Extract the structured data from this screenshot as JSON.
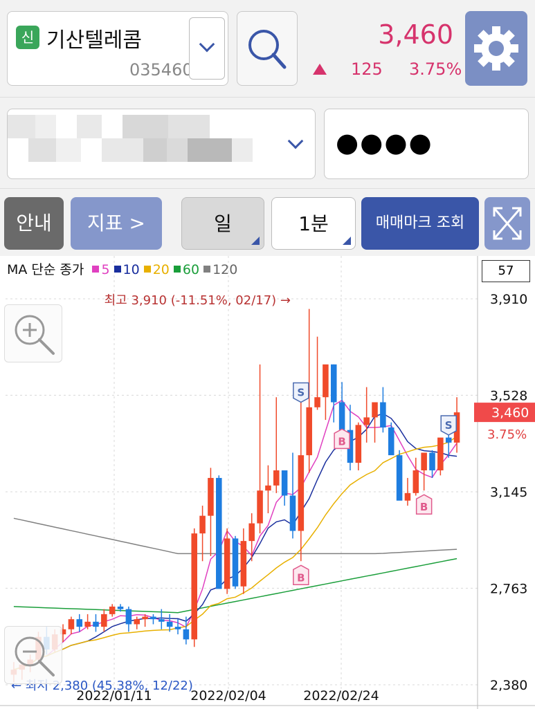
{
  "header": {
    "badge": "신",
    "stock_name": "기산텔레콤",
    "stock_code": "035460",
    "price": "3,460",
    "change": "125",
    "change_pct": "3.75%"
  },
  "account": {
    "password_masked": "●●●●"
  },
  "toolbar": {
    "guide": "안내",
    "indicator": "지표 >",
    "period": "일",
    "interval": "1분",
    "trade_mark": "매매마크 조회"
  },
  "legend": {
    "label": "MA 단순 종가",
    "items": [
      {
        "label": "5",
        "color": "#e040c0"
      },
      {
        "label": "10",
        "color": "#1a2f9e"
      },
      {
        "label": "20",
        "color": "#e8b000"
      },
      {
        "label": "60",
        "color": "#1a9e3a"
      },
      {
        "label": "120",
        "color": "#808080"
      }
    ]
  },
  "count_box": "57",
  "colors": {
    "up": "#f04a2a",
    "down": "#1e7de0",
    "accent": "#3a56a8",
    "price": "#d6336c"
  },
  "chart_data": {
    "type": "candlestick",
    "y_ticks": [
      "3,910",
      "3,528",
      "3,145",
      "2,763",
      "2,380"
    ],
    "ylim": [
      2380,
      3910
    ],
    "x_ticks": [
      "2022/01/11",
      "2022/02/04",
      "2022/02/24"
    ],
    "high_annotation": "최고 3,910 (-11.51%, 02/17) →",
    "low_annotation": "← 최저 2,380 (45.38%, 12/22)",
    "current_price": "3,460",
    "current_pct": "3.75%",
    "marks": [
      {
        "label": "S",
        "index": 35
      },
      {
        "label": "B",
        "index": 35
      },
      {
        "label": "B",
        "index": 40
      },
      {
        "label": "B",
        "index": 50
      },
      {
        "label": "S",
        "index": 53
      }
    ],
    "candles": [
      [
        2420,
        2470,
        2390,
        2440
      ],
      [
        2440,
        2470,
        2400,
        2460
      ],
      [
        2460,
        2500,
        2430,
        2480
      ],
      [
        2480,
        2590,
        2470,
        2570
      ],
      [
        2570,
        2610,
        2500,
        2520
      ],
      [
        2520,
        2600,
        2510,
        2580
      ],
      [
        2580,
        2620,
        2550,
        2600
      ],
      [
        2600,
        2650,
        2580,
        2640
      ],
      [
        2640,
        2660,
        2590,
        2610
      ],
      [
        2610,
        2660,
        2600,
        2630
      ],
      [
        2630,
        2660,
        2590,
        2610
      ],
      [
        2610,
        2680,
        2590,
        2660
      ],
      [
        2660,
        2700,
        2650,
        2690
      ],
      [
        2690,
        2700,
        2670,
        2680
      ],
      [
        2680,
        2690,
        2590,
        2620
      ],
      [
        2620,
        2650,
        2600,
        2640
      ],
      [
        2640,
        2660,
        2610,
        2650
      ],
      [
        2650,
        2660,
        2620,
        2640
      ],
      [
        2640,
        2680,
        2600,
        2630
      ],
      [
        2630,
        2660,
        2590,
        2610
      ],
      [
        2610,
        2640,
        2580,
        2600
      ],
      [
        2600,
        2650,
        2540,
        2560
      ],
      [
        2560,
        3000,
        2530,
        2980
      ],
      [
        2980,
        3090,
        2870,
        3050
      ],
      [
        3050,
        3240,
        2890,
        3200
      ],
      [
        3200,
        3210,
        2780,
        2760
      ],
      [
        2760,
        3000,
        2740,
        2960
      ],
      [
        2960,
        2970,
        2760,
        2770
      ],
      [
        2770,
        3000,
        2740,
        2950
      ],
      [
        2950,
        3060,
        2870,
        3020
      ],
      [
        3020,
        3650,
        2980,
        3150
      ],
      [
        3150,
        3250,
        3060,
        3170
      ],
      [
        3170,
        3520,
        3140,
        3230
      ],
      [
        3230,
        3230,
        3090,
        3130
      ],
      [
        3130,
        3300,
        2960,
        2990
      ],
      [
        2990,
        3500,
        2870,
        3290
      ],
      [
        3290,
        3870,
        3220,
        3480
      ],
      [
        3480,
        3760,
        3470,
        3520
      ],
      [
        3520,
        3600,
        3430,
        3650
      ],
      [
        3650,
        3650,
        3420,
        3500
      ],
      [
        3500,
        3580,
        3410,
        3390
      ],
      [
        3390,
        3490,
        3230,
        3260
      ],
      [
        3260,
        3420,
        3230,
        3410
      ],
      [
        3410,
        3560,
        3340,
        3440
      ],
      [
        3440,
        3470,
        3340,
        3500
      ],
      [
        3500,
        3560,
        3380,
        3400
      ],
      [
        3400,
        3420,
        3310,
        3290
      ],
      [
        3290,
        3310,
        3170,
        3110
      ],
      [
        3110,
        3200,
        3090,
        3140
      ],
      [
        3140,
        3280,
        3130,
        3230
      ],
      [
        3230,
        3270,
        3150,
        3300
      ],
      [
        3300,
        3310,
        3200,
        3230
      ],
      [
        3230,
        3330,
        3210,
        3360
      ],
      [
        3360,
        3370,
        3280,
        3340
      ],
      [
        3340,
        3520,
        3300,
        3460
      ]
    ]
  }
}
